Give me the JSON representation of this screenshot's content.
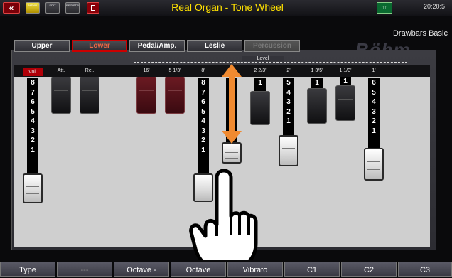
{
  "header": {
    "title": "Real Organ - Tone Wheel",
    "clock": "20:20:5",
    "back_icon": "«",
    "menu_label": "MENU",
    "edit_label": "EDIT",
    "reg_label": "REGISTR",
    "split_label": "↑↑"
  },
  "subtitle": "Drawbars Basic",
  "brand": "Böhm",
  "tabs": [
    {
      "label": "Upper",
      "state": "normal"
    },
    {
      "label": "Lower",
      "state": "active"
    },
    {
      "label": "Pedal/Amp.",
      "state": "normal"
    },
    {
      "label": "Leslie",
      "state": "normal"
    },
    {
      "label": "Percussion",
      "state": "disabled"
    }
  ],
  "level_label": "Level",
  "columns": {
    "vol": "Vol.",
    "att": "Att.",
    "rel": "Rel.",
    "f16": "16'",
    "f513": "5 1/3'",
    "f8": "8'",
    "f223": "2 2/3'",
    "f2": "2'",
    "f135": "1 3/5'",
    "f113": "1 1/3'",
    "f1": "1'"
  },
  "drawbars": {
    "vol": {
      "numbers": [
        "8",
        "7",
        "6",
        "5",
        "4",
        "3",
        "2",
        "1"
      ],
      "level": 8
    },
    "f8": {
      "numbers": [
        "8",
        "7",
        "6",
        "5",
        "4",
        "3",
        "2",
        "1"
      ],
      "level": 8
    },
    "f223": {
      "numbers": [
        "1"
      ],
      "level": 1
    },
    "f2": {
      "numbers": [
        "5",
        "4",
        "3",
        "2",
        "1"
      ],
      "level": 5
    },
    "f135": {
      "numbers": [
        "1"
      ],
      "level": 1
    },
    "f113": {
      "numbers": [
        "1"
      ],
      "level": 1
    },
    "f1": {
      "numbers": [
        "6",
        "5",
        "4",
        "3",
        "2",
        "1"
      ],
      "level": 6
    }
  },
  "fkeys": [
    "Type",
    "---",
    "Octave -",
    "Octave",
    "Vibrato",
    "C1",
    "C2",
    "C3"
  ],
  "colors": {
    "title": "#ffe100",
    "active_tab_border": "#cc0000",
    "arrow": "#f08a30",
    "vol_label_bg": "#b00008"
  },
  "icons": {
    "gesture": "hand-pointer-icon",
    "arrow": "double-arrow-icon"
  }
}
